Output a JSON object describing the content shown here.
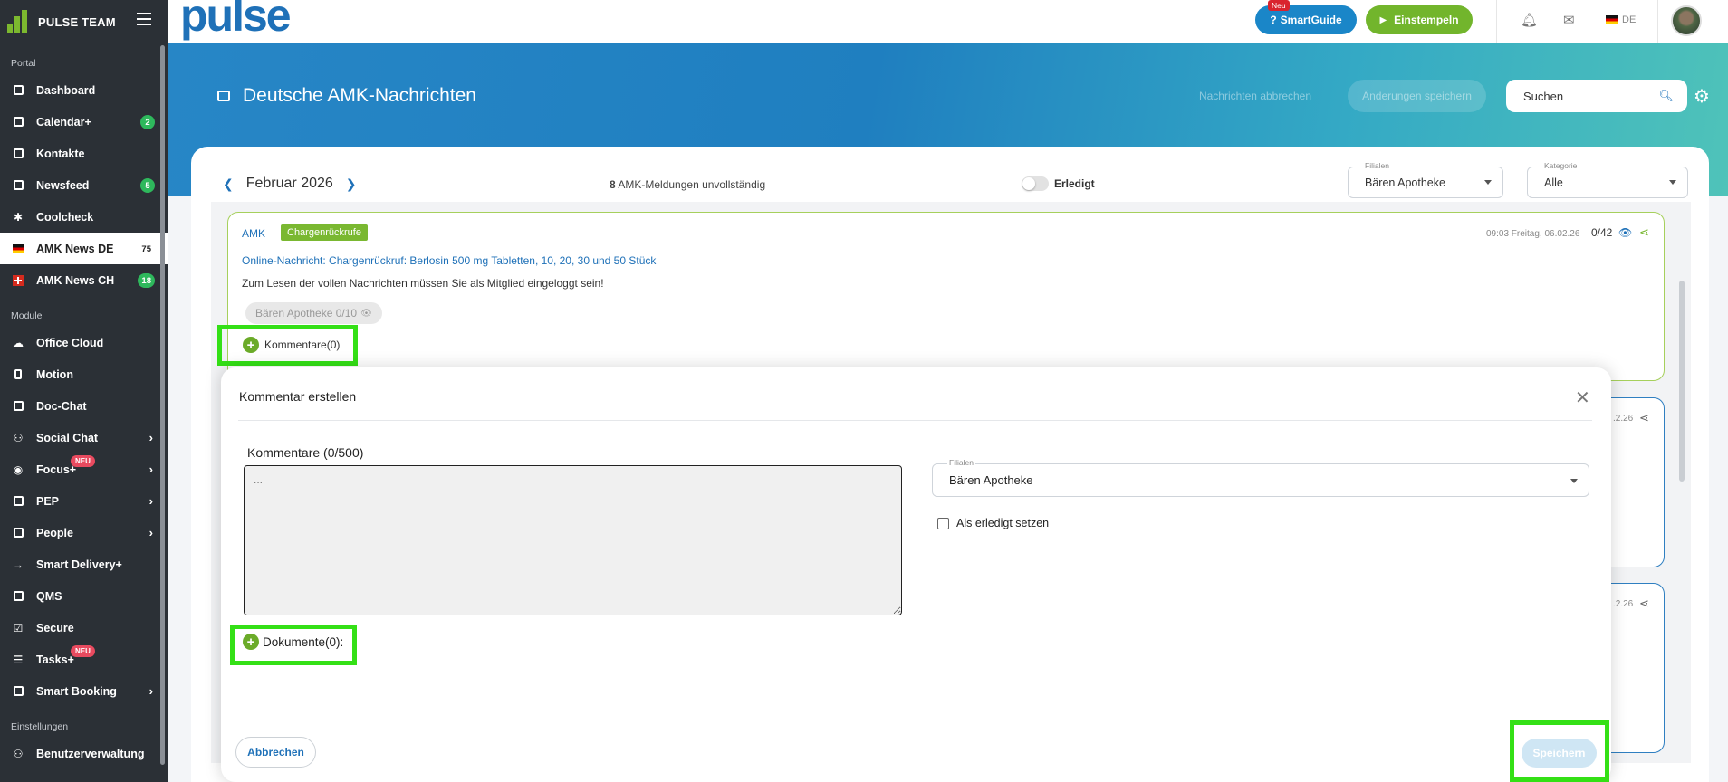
{
  "sidebar": {
    "brand": "PULSE TEAM",
    "sections": {
      "portal": "Portal",
      "module": "Module",
      "einstellungen": "Einstellungen"
    },
    "items": [
      {
        "label": "Dashboard",
        "icon": "dashboard-icon"
      },
      {
        "label": "Calendar+",
        "icon": "calendar-icon",
        "badge": "2"
      },
      {
        "label": "Kontakte",
        "icon": "contacts-icon"
      },
      {
        "label": "Newsfeed",
        "icon": "newsfeed-icon",
        "badge": "5"
      },
      {
        "label": "Coolcheck",
        "icon": "coolcheck-icon"
      },
      {
        "label": "AMK News DE",
        "icon": "flag-de-icon",
        "badge": "75"
      },
      {
        "label": "AMK News CH",
        "icon": "flag-ch-icon",
        "badge": "18"
      },
      {
        "label": "Office Cloud",
        "icon": "cloud-icon"
      },
      {
        "label": "Motion",
        "icon": "motion-icon"
      },
      {
        "label": "Doc-Chat",
        "icon": "chat-icon"
      },
      {
        "label": "Social Chat",
        "icon": "social-chat-icon"
      },
      {
        "label": "Focus+",
        "icon": "focus-icon",
        "new": "NEU"
      },
      {
        "label": "PEP",
        "icon": "pep-icon"
      },
      {
        "label": "People",
        "icon": "people-icon"
      },
      {
        "label": "Smart Delivery+",
        "icon": "delivery-icon"
      },
      {
        "label": "QMS",
        "icon": "qms-icon"
      },
      {
        "label": "Secure",
        "icon": "secure-icon"
      },
      {
        "label": "Tasks+",
        "icon": "tasks-icon",
        "new": "NEU"
      },
      {
        "label": "Smart Booking",
        "icon": "booking-icon"
      },
      {
        "label": "Benutzerverwaltung",
        "icon": "users-icon"
      }
    ]
  },
  "topbar": {
    "logo": "pulse",
    "smartguide_label": "SmartGuide",
    "smartguide_new": "Neu",
    "stamp_label": "Einstempeln",
    "lang": "DE"
  },
  "header": {
    "title": "Deutsche AMK-Nachrichten",
    "btn_disabled_1": "Nachrichten abbrechen",
    "btn_disabled_2": "Änderungen speichern",
    "search_placeholder": "Suchen"
  },
  "filters": {
    "month": "Februar 2026",
    "incomplete_count": "8",
    "incomplete_text": "AMK-Meldungen unvollständig",
    "toggle_label": "Erledigt",
    "filialen_label": "Filialen",
    "filialen_value": "Bären Apotheke",
    "kategorie_label": "Kategorie",
    "kategorie_value": "Alle"
  },
  "card": {
    "source": "AMK",
    "tag": "Chargenrückrufe",
    "time": "09:03 Freitag, 06.02.26",
    "count": "0/42",
    "link": "Online-Nachricht: Chargenrückruf: Berlosin 500 mg Tabletten, 10, 20, 30 und 50 Stück",
    "text": "Zum Lesen der vollen Nachrichten müssen Sie als Mitglied eingeloggt sein!",
    "chip": "Bären Apotheke 0/10",
    "comments": "Kommentare(0)",
    "other_date": ".2.26"
  },
  "modal": {
    "title": "Kommentar erstellen",
    "comment_label": "Kommentare (0/500)",
    "textarea_placeholder": "...",
    "documents": "Dokumente(0):",
    "filialen_label": "Filialen",
    "filialen_value": "Bären Apotheke",
    "checkbox_label": "Als erledigt setzen",
    "cancel": "Abbrechen",
    "save": "Speichern"
  },
  "colors": {
    "primary": "#1f71b8",
    "green": "#72b52c",
    "highlight": "#34e016",
    "sidebar": "#2b3036"
  }
}
